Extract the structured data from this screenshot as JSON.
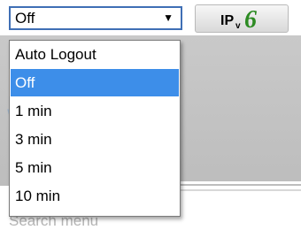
{
  "auto_logout_select": {
    "value": "Off",
    "arrow_icon": "dropdown-arrow-icon",
    "options": [
      {
        "label": "Auto Logout"
      },
      {
        "label": "Off",
        "selected": true
      },
      {
        "label": "1 min"
      },
      {
        "label": "3 min"
      },
      {
        "label": "5 min"
      },
      {
        "label": "10 min"
      }
    ]
  },
  "ipv6_badge": {
    "ip": "IP",
    "v": "v",
    "six": "6",
    "accent_color": "#2d8b23"
  },
  "search": {
    "placeholder": "Search menu"
  },
  "colors": {
    "selection": "#3d8ee9",
    "select_border": "#3f6fb5"
  }
}
